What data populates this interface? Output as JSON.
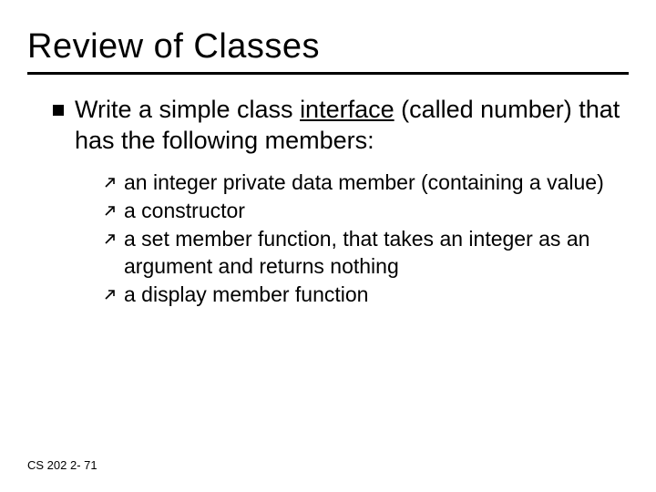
{
  "title": "Review of Classes",
  "lead": {
    "pre": "Write a simple class ",
    "underlined": "interface",
    "post": " (called number) that has the following members:"
  },
  "items": [
    "an integer private data member (containing a value)",
    "a constructor",
    "a set member function, that takes an integer as an argument and returns nothing",
    "a display member function"
  ],
  "footer": "CS 202   2- 71"
}
